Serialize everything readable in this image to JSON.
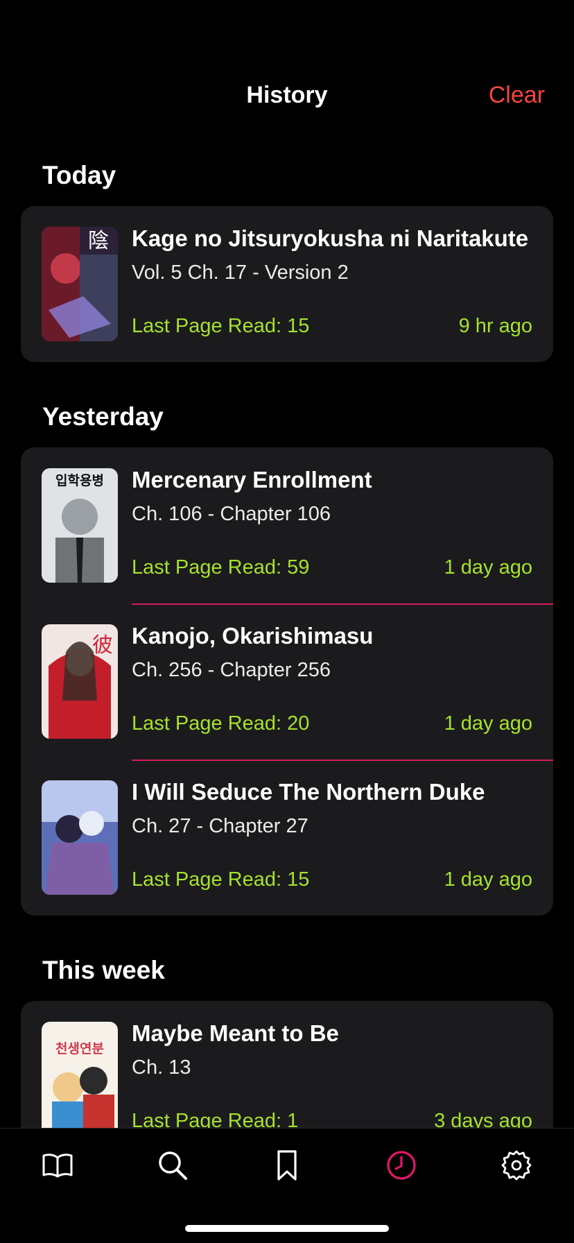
{
  "header": {
    "title": "History",
    "clear_label": "Clear"
  },
  "sections": [
    {
      "title": "Today",
      "items": [
        {
          "title": "Kage no Jitsuryokusha ni Naritakute",
          "chapter": "Vol. 5 Ch. 17 - Version 2",
          "last_read": "Last Page Read: 15",
          "time": "9 hr ago",
          "cover_text": "陰"
        }
      ]
    },
    {
      "title": "Yesterday",
      "items": [
        {
          "title": "Mercenary Enrollment",
          "chapter": "Ch. 106 - Chapter 106",
          "last_read": "Last Page Read: 59",
          "time": "1 day ago",
          "cover_text": "입학용병"
        },
        {
          "title": "Kanojo, Okarishimasu",
          "chapter": "Ch. 256 - Chapter 256",
          "last_read": "Last Page Read: 20",
          "time": "1 day ago",
          "cover_text": "彼"
        },
        {
          "title": "I Will Seduce The Northern Duke",
          "chapter": "Ch. 27 - Chapter 27",
          "last_read": "Last Page Read: 15",
          "time": "1 day ago",
          "cover_text": ""
        }
      ]
    },
    {
      "title": "This week",
      "items": [
        {
          "title": "Maybe Meant to Be",
          "chapter": "Ch. 13",
          "last_read": "Last Page Read: 1",
          "time": "3 days ago",
          "cover_text": "천생연분"
        }
      ]
    }
  ],
  "tabbar": {
    "tabs": [
      {
        "name": "library",
        "icon": "book-icon",
        "active": false
      },
      {
        "name": "search",
        "icon": "search-icon",
        "active": false
      },
      {
        "name": "bookmarks",
        "icon": "bookmark-icon",
        "active": false
      },
      {
        "name": "history",
        "icon": "clock-icon",
        "active": true
      },
      {
        "name": "settings",
        "icon": "gear-icon",
        "active": false
      }
    ]
  },
  "colors": {
    "background": "#000000",
    "card": "#1b1b1d",
    "accent_red": "#f5453f",
    "accent_green": "#a6e22e",
    "accent_pink": "#e4166a",
    "divider": "#d61a5a"
  }
}
